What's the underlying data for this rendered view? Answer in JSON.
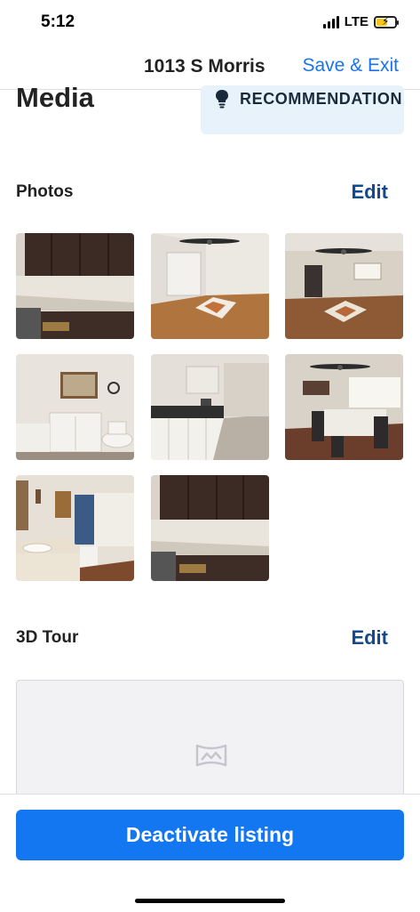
{
  "status_bar": {
    "time": "5:12",
    "network": "LTE",
    "icons": [
      "signal-icon",
      "battery-charging-icon"
    ]
  },
  "header": {
    "title": "1013 S Morris",
    "action_label": "Save & Exit"
  },
  "page": {
    "title": "Media"
  },
  "recommendation": {
    "label": "RECOMMENDATION",
    "icon": "lightbulb-icon"
  },
  "photos": {
    "title": "Photos",
    "edit_label": "Edit",
    "items": [
      {
        "subject": "kitchen"
      },
      {
        "subject": "bedroom"
      },
      {
        "subject": "living-room"
      },
      {
        "subject": "bathroom"
      },
      {
        "subject": "kitchen-sink"
      },
      {
        "subject": "dining-room"
      },
      {
        "subject": "bathroom-vanity"
      },
      {
        "subject": "kitchen-counter"
      }
    ]
  },
  "tour": {
    "title": "3D Tour",
    "edit_label": "Edit",
    "icon": "panorama-icon"
  },
  "footer": {
    "deactivate_label": "Deactivate listing"
  },
  "colors": {
    "accent": "#1377f2",
    "link": "#1a73e8",
    "edit": "#134a8e",
    "reco_bg": "#e8f2fb"
  }
}
